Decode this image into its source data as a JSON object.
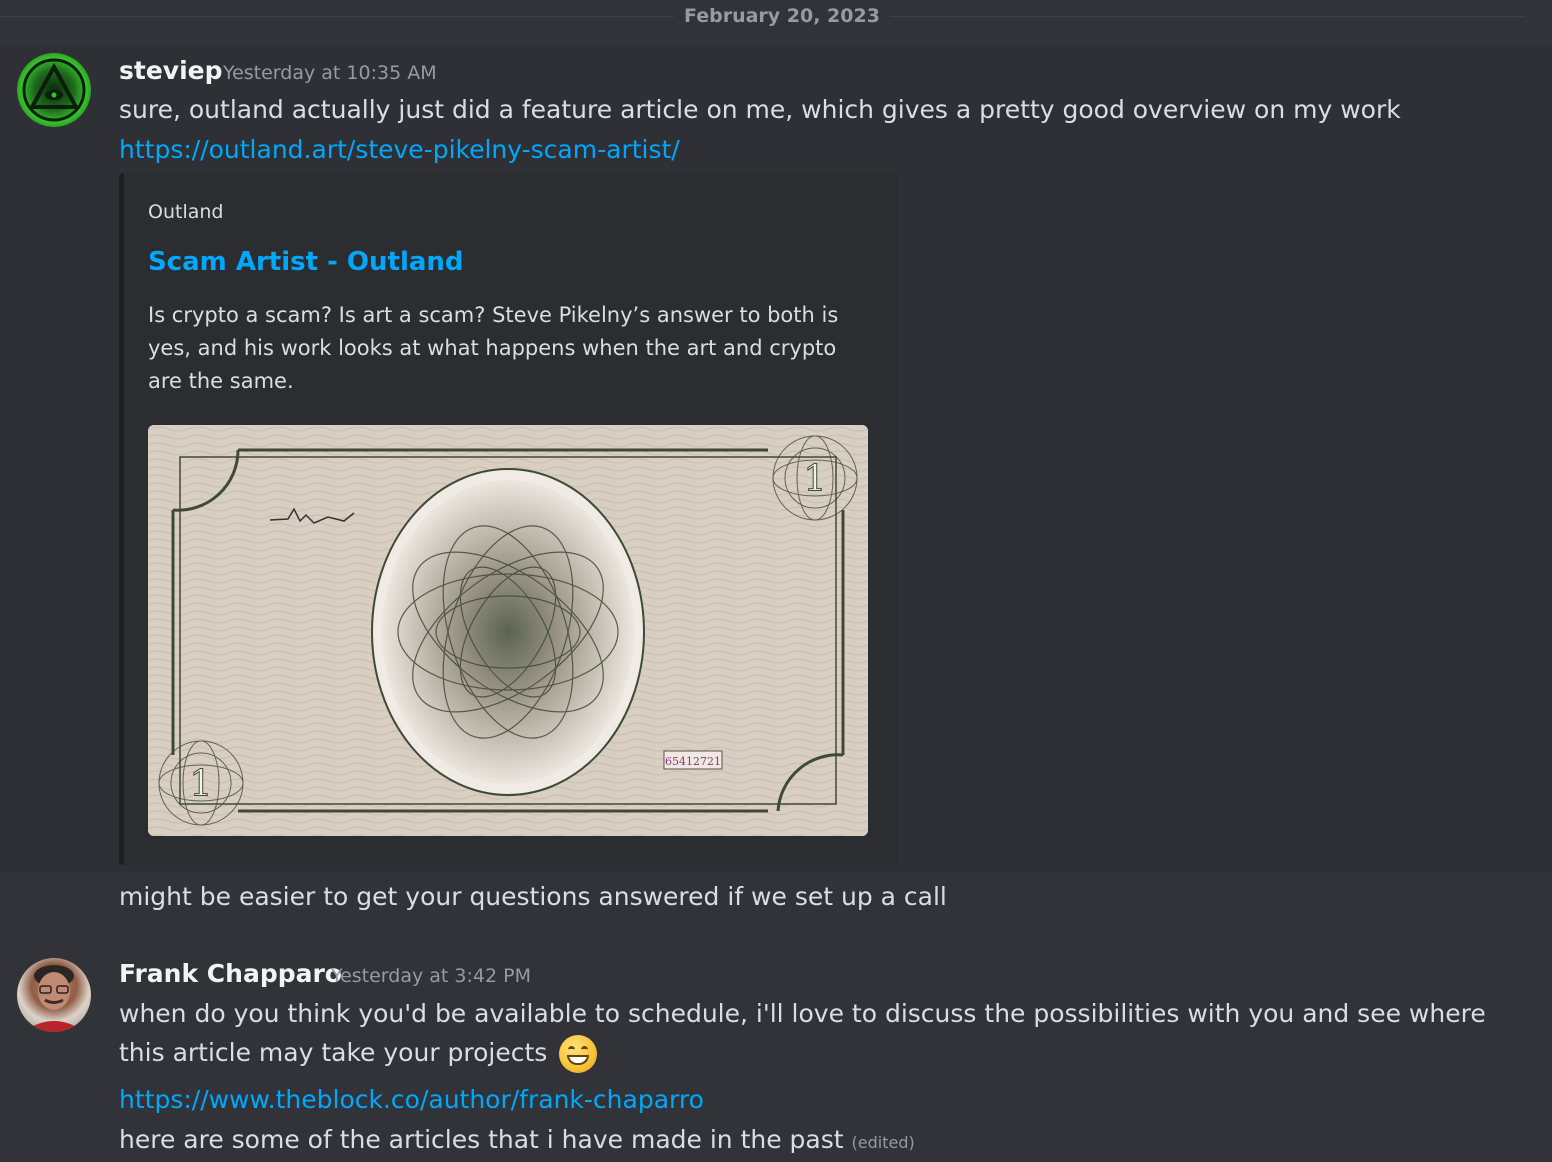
{
  "divider": {
    "date": "February 20, 2023"
  },
  "messages": [
    {
      "author": "steviep",
      "timestamp": "Yesterday at 10:35 AM",
      "text": "sure, outland actually just did a feature article on me, which gives a pretty good overview on my work",
      "link": "https://outland.art/steve-pikelny-scam-artist/",
      "embed": {
        "provider": "Outland",
        "title": "Scam Artist - Outland",
        "description": "Is crypto a scam? Is art a scam? Steve Pikelny’s answer to both is yes, and his work looks at what happens when the art and crypto are the same.",
        "image": {
          "denomination": "1",
          "serial": "65412721",
          "colors": {
            "paper": "#d7cdc1",
            "ink": "#3f4a35"
          }
        }
      },
      "followup": "might be easier to get your questions answered if we set up a call"
    },
    {
      "author": "Frank Chapparo",
      "timestamp": "Yesterday at 3:42 PM",
      "text_line1": "when do you think you'd be available to schedule, i'll love to discuss the possibilities with you and see where",
      "text_line2": "this article may take your projects",
      "emoji": "grinning-face-emoji",
      "link": "https://www.theblock.co/author/frank-chaparro",
      "followup": "here are some of the articles that i have made in the past",
      "edited_label": "(edited)"
    }
  ],
  "colors": {
    "background": "#313338",
    "link": "#00a8fc",
    "username": "#f2f3f5",
    "muted": "#949ba4"
  }
}
